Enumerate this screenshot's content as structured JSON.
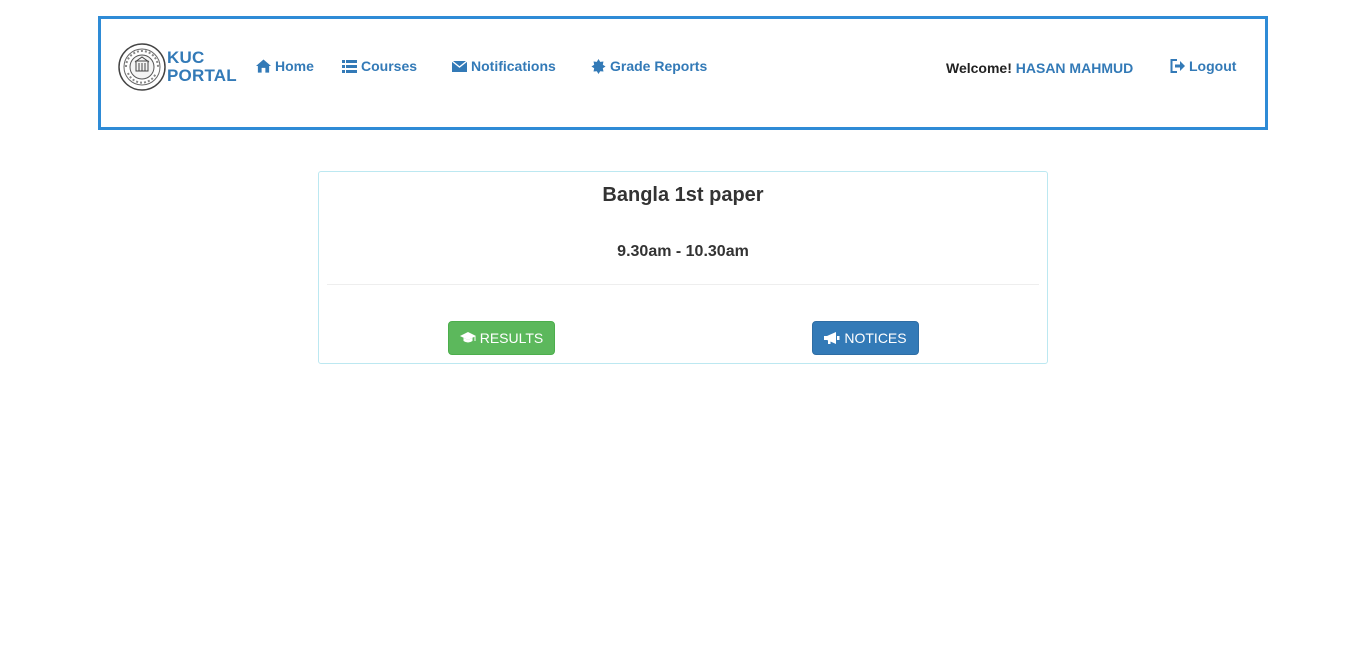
{
  "brand": {
    "line1": "KUC",
    "line2": "PORTAL",
    "logo_icon": "university-seal-icon"
  },
  "nav": {
    "home": "Home",
    "courses": "Courses",
    "notifications": "Notifications",
    "grade_reports": "Grade Reports",
    "logout": "Logout"
  },
  "user": {
    "welcome_label": "Welcome!",
    "name": "HASAN MAHMUD"
  },
  "exam_card": {
    "title": "Bangla 1st paper",
    "time": "9.30am - 10.30am",
    "results_label": "RESULTS",
    "notices_label": "NOTICES"
  },
  "colors": {
    "accent": "#337ab7",
    "nav_border": "#2e8bd6",
    "success": "#5cb85c",
    "primary": "#337ab7",
    "card_border": "#bce8f1"
  },
  "icons": {
    "home": "home-icon",
    "courses": "list-icon",
    "notifications": "envelope-icon",
    "grade_reports": "certificate-icon",
    "logout": "logout-icon",
    "results": "graduation-cap-icon",
    "notices": "bullhorn-icon"
  }
}
